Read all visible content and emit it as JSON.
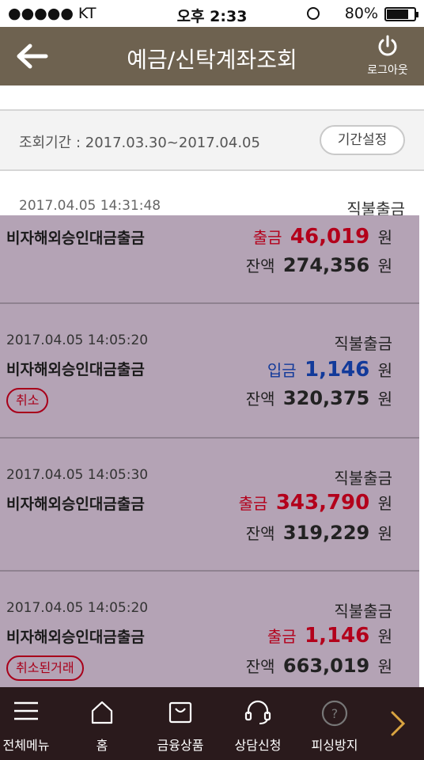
{
  "status_bar": {
    "carrier": "●●●●● KT",
    "time": "오후 2:33",
    "battery_pct": "80%",
    "battery_level": 0.8
  },
  "header": {
    "title": "예금/신탁계좌조회",
    "logout_label": "로그아웃"
  },
  "period": {
    "label": "조회기간 : 2017.03.30~2017.04.05",
    "button": "기간설정"
  },
  "transactions": [
    {
      "date": "2017.04.05 14:31:48",
      "type": "직불출금",
      "desc": "비자해외승인대금출금",
      "amount_kind": "출금",
      "amount": "46,019",
      "amount_unit": "원",
      "balance_label": "잔액",
      "balance": "274,356",
      "balance_unit": "원"
    },
    {
      "date": "2017.04.05 14:05:20",
      "type": "직불출금",
      "desc": "비자해외승인대금출금",
      "amount_kind": "입금",
      "amount": "1,146",
      "amount_unit": "원",
      "balance_label": "잔액",
      "balance": "320,375",
      "balance_unit": "원",
      "badge": "취소"
    },
    {
      "date": "2017.04.05 14:05:30",
      "type": "직불출금",
      "desc": "비자해외승인대금출금",
      "amount_kind": "출금",
      "amount": "343,790",
      "amount_unit": "원",
      "balance_label": "잔액",
      "balance": "319,229",
      "balance_unit": "원"
    },
    {
      "date": "2017.04.05 14:05:20",
      "type": "직불출금",
      "desc": "비자해외승인대금출금",
      "amount_kind": "출금",
      "amount": "1,146",
      "amount_unit": "원",
      "balance_label": "잔액",
      "balance": "663,019",
      "balance_unit": "원",
      "badge": "취소된거래"
    }
  ],
  "tabbar": {
    "items": [
      {
        "label": "전체메뉴",
        "icon": "menu-icon"
      },
      {
        "label": "홈",
        "icon": "home-icon"
      },
      {
        "label": "금융상품",
        "icon": "bag-icon"
      },
      {
        "label": "상담신청",
        "icon": "headset-icon"
      },
      {
        "label": "피싱방지",
        "icon": "question-icon"
      }
    ]
  },
  "colors": {
    "header": "#6e6250",
    "overlay": "#b4a3b5",
    "withdraw": "#b3001b",
    "deposit": "#123a9a",
    "tabbar": "#2a1a1c"
  }
}
